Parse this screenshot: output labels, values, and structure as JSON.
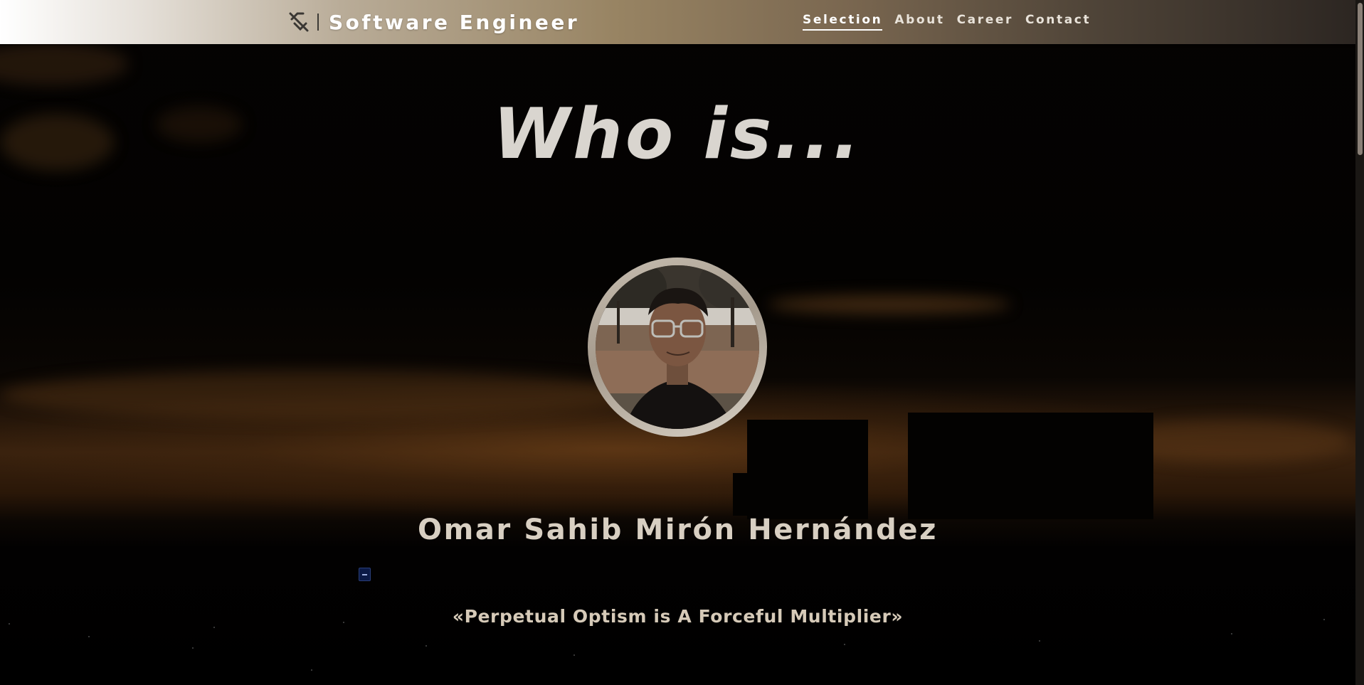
{
  "header": {
    "brand_title": "Software Engineer",
    "brand_icon": "slashed-tag-icon",
    "nav": [
      {
        "label": "Selection",
        "active": true
      },
      {
        "label": "About",
        "active": false
      },
      {
        "label": "Career",
        "active": false
      },
      {
        "label": "Contact",
        "active": false
      }
    ]
  },
  "hero": {
    "title": "Who is...",
    "name": "Omar Sahib Mirón Hernández",
    "quote": "«Perpetual Optism is A Forceful Multiplier»",
    "avatar": "profile-photo"
  },
  "colors": {
    "header_gradient_start": "#ffffff",
    "header_gradient_end": "#2b2521",
    "accent": "#d8cfc2",
    "background": "#000000"
  }
}
